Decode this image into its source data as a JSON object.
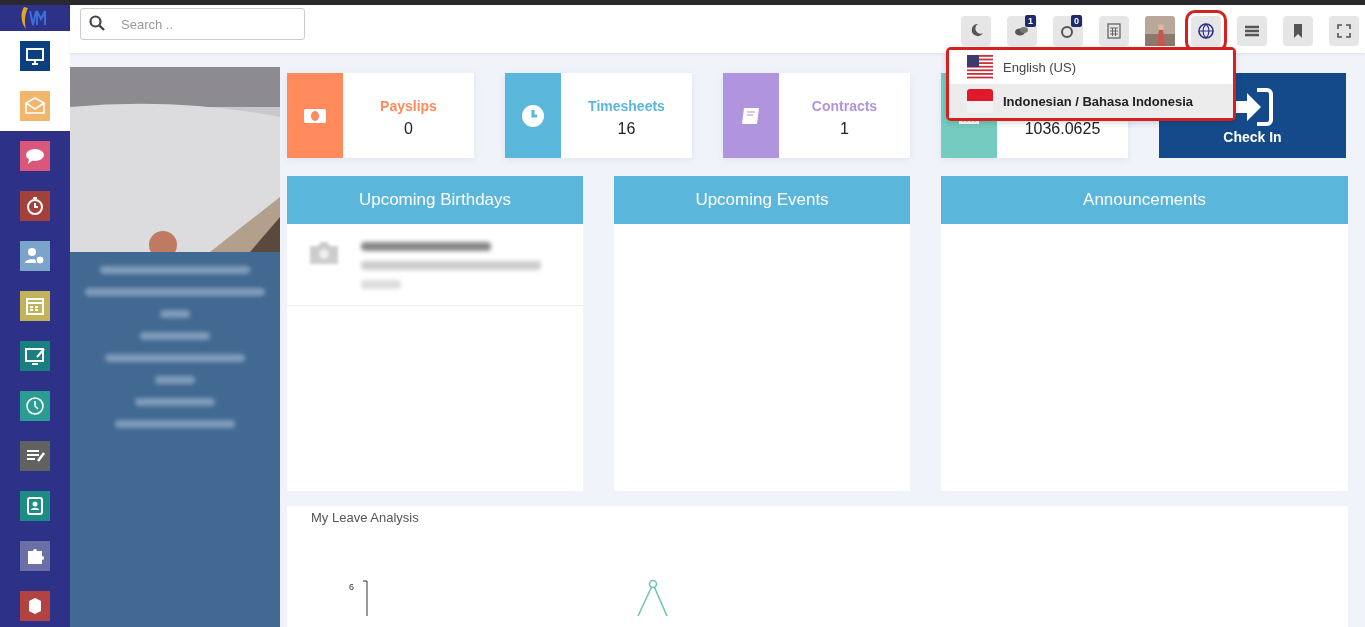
{
  "sidebar": {
    "items": [
      {
        "kind": "monitor",
        "color": "#0b3f7f",
        "selected": true
      },
      {
        "kind": "mail",
        "color": "#f1b56b",
        "selected": true
      },
      {
        "kind": "chat",
        "color": "#d9577a",
        "selected": false
      },
      {
        "kind": "stopwatch",
        "color": "#a4403c",
        "selected": false
      },
      {
        "kind": "user-clock",
        "color": "#7aa4c9",
        "selected": false
      },
      {
        "kind": "calendar",
        "color": "#c2b25a",
        "selected": false
      },
      {
        "kind": "screen-edit",
        "color": "#1a7f7f",
        "selected": false
      },
      {
        "kind": "clock-circle",
        "color": "#2a9c94",
        "selected": false
      },
      {
        "kind": "note",
        "color": "#616161",
        "selected": false
      },
      {
        "kind": "contact",
        "color": "#1e8c86",
        "selected": false
      },
      {
        "kind": "puzzle",
        "color": "#6a6fa6",
        "selected": false
      },
      {
        "kind": "box",
        "color": "#b34242",
        "selected": false
      }
    ]
  },
  "search": {
    "placeholder": "Search .."
  },
  "toolbar": [
    {
      "kind": "moon",
      "highlighted": false
    },
    {
      "kind": "chat",
      "badge": "1",
      "highlighted": false
    },
    {
      "kind": "reminder",
      "badge": "0",
      "highlighted": false
    },
    {
      "kind": "calculator",
      "highlighted": false
    },
    {
      "kind": "avatar",
      "highlighted": false
    },
    {
      "kind": "globe",
      "highlighted": true
    },
    {
      "kind": "menu",
      "highlighted": false
    },
    {
      "kind": "bookmark",
      "highlighted": false
    },
    {
      "kind": "fullscreen",
      "highlighted": false
    }
  ],
  "language_menu": {
    "items": [
      {
        "label": "English (US)",
        "kind": "us",
        "selected": false
      },
      {
        "label": "Indonesian / Bahasa Indonesia",
        "kind": "id",
        "selected": true
      }
    ]
  },
  "stat_cards": [
    {
      "kind": "money",
      "label": "Payslips",
      "value": "0",
      "color": "#ff8a5b"
    },
    {
      "kind": "clock",
      "label": "Timesheets",
      "value": "16",
      "color": "#5bb6dc"
    },
    {
      "kind": "book",
      "label": "Contracts",
      "value": "1",
      "color": "#b094dd"
    },
    {
      "kind": "building",
      "value": "1036.0625",
      "color": "#74cbbf"
    }
  ],
  "check_in": {
    "label": "Check In"
  },
  "panels": [
    {
      "title": "Upcoming Birthdays",
      "blurred_entry": true
    },
    {
      "title": "Upcoming Events",
      "blurred_entry": false
    },
    {
      "title": "Announcements",
      "blurred_entry": false
    }
  ],
  "leave_analysis": {
    "title": "My Leave Analysis",
    "y_tick": "6"
  }
}
